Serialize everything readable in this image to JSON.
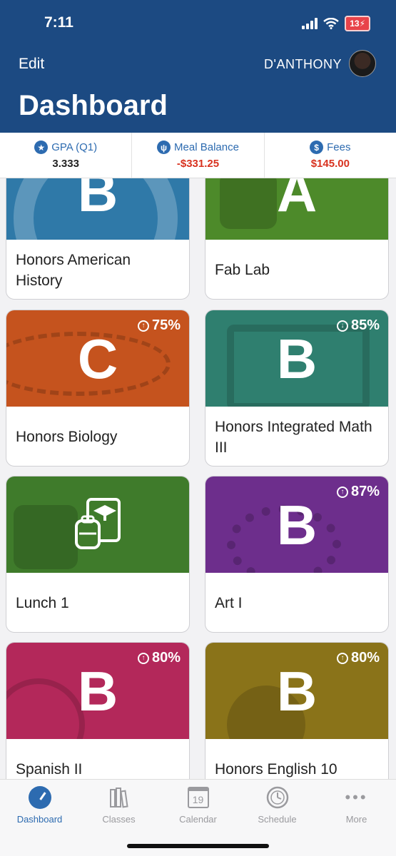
{
  "status": {
    "time": "7:11",
    "battery": "13"
  },
  "header": {
    "edit_label": "Edit",
    "user_name": "D'ANTHONY",
    "title": "Dashboard"
  },
  "summary": [
    {
      "label": "GPA (Q1)",
      "value": "3.333",
      "icon": "star-icon"
    },
    {
      "label": "Meal Balance",
      "value": "-$331.25",
      "icon": "utensils-icon",
      "color": "#d8321f"
    },
    {
      "label": "Fees",
      "value": "$145.00",
      "icon": "dollar-icon",
      "color": "#d8321f"
    }
  ],
  "courses": [
    {
      "name": "Honors American History",
      "grade": "B",
      "percent": "",
      "trend": "",
      "color": "#2f79a8"
    },
    {
      "name": "Fab Lab",
      "grade": "A",
      "percent": "",
      "trend": "",
      "color": "#4d8a2a"
    },
    {
      "name": "Honors Biology",
      "grade": "C",
      "percent": "75%",
      "trend": "up",
      "color": "#c5531e"
    },
    {
      "name": "Honors Integrated Math III",
      "grade": "B",
      "percent": "85%",
      "trend": "down",
      "color": "#2f7f6f"
    },
    {
      "name": "Lunch 1",
      "grade": "",
      "percent": "",
      "trend": "",
      "color": "#3f7b2b",
      "icon": "backpack-book-icon"
    },
    {
      "name": "Art I",
      "grade": "B",
      "percent": "87%",
      "trend": "up",
      "color": "#6d2e8c"
    },
    {
      "name": "Spanish II",
      "grade": "B",
      "percent": "80%",
      "trend": "up",
      "color": "#b3285a"
    },
    {
      "name": "Honors English 10",
      "grade": "B",
      "percent": "80%",
      "trend": "up",
      "color": "#8a7319"
    }
  ],
  "tabs": [
    {
      "label": "Dashboard",
      "icon": "speedometer-icon",
      "active": true
    },
    {
      "label": "Classes",
      "icon": "books-icon",
      "active": false
    },
    {
      "label": "Calendar",
      "icon": "calendar-icon",
      "active": false,
      "day": "19"
    },
    {
      "label": "Schedule",
      "icon": "clock-icon",
      "active": false
    },
    {
      "label": "More",
      "icon": "more-dots-icon",
      "active": false
    }
  ]
}
